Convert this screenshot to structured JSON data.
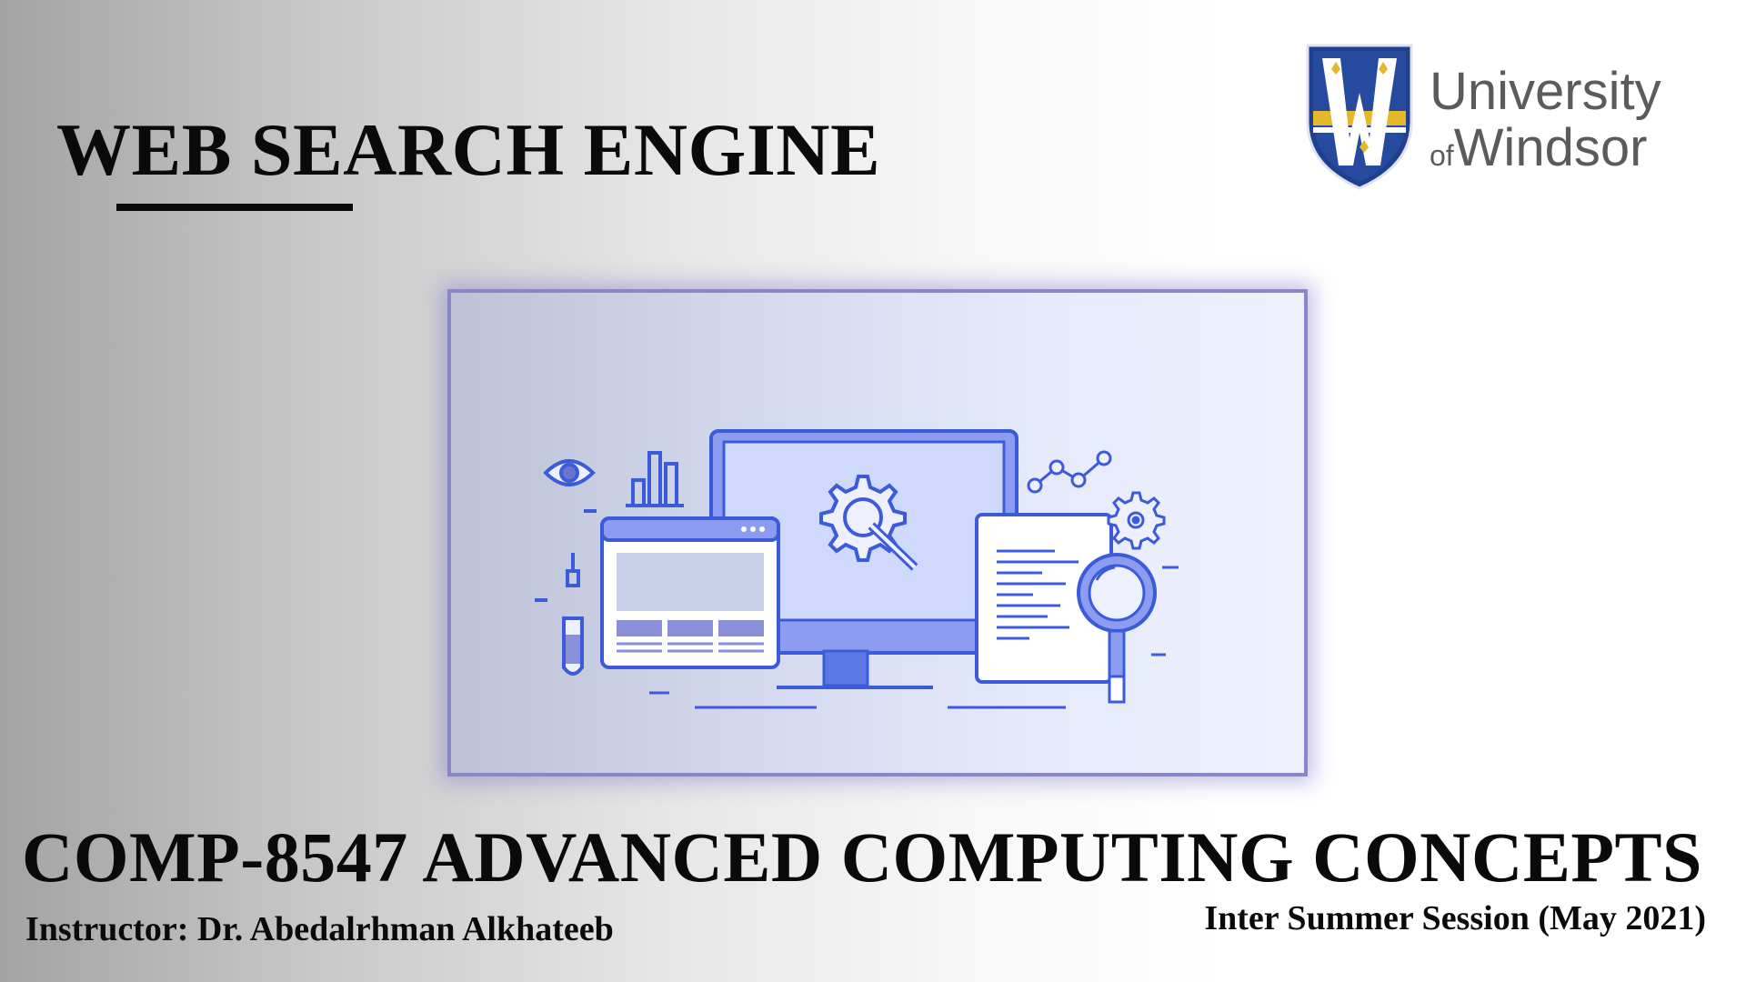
{
  "slide": {
    "title": "WEB SEARCH ENGINE",
    "course_title": "COMP-8547 ADVANCED COMPUTING CONCEPTS",
    "instructor": "Instructor: Dr. Abedalrhman Alkhateeb",
    "session": "Inter Summer Session (May 2021)"
  },
  "logo": {
    "line1": "University",
    "line2_prefix": "of",
    "line2_main": "Windsor",
    "crest_icon": "university-crest-icon"
  },
  "illustration": {
    "icons": [
      "eye-icon",
      "bar-chart-icon",
      "monitor-icon",
      "gear-wrench-icon",
      "browser-window-icon",
      "document-icon",
      "magnifier-icon",
      "line-graph-icon",
      "small-gear-icon",
      "test-tube-icon"
    ]
  },
  "colors": {
    "accent_blue": "#3b5bdb",
    "crest_blue": "#1f3f8f",
    "crest_gold": "#e5b82a",
    "frame_border": "#8a86c8",
    "text": "#0a0a0a",
    "logo_gray": "#5b5b5b"
  }
}
